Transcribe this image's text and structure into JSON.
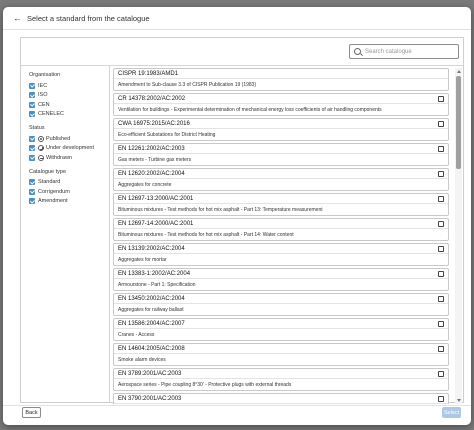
{
  "dialog": {
    "title": "Select a standard from the catalogue",
    "back_label": "Back",
    "select_label": "Select"
  },
  "search": {
    "placeholder": "Search catalogue"
  },
  "filters": {
    "organisation": {
      "title": "Organisation",
      "options": [
        {
          "label": "IEC",
          "checked": true
        },
        {
          "label": "ISO",
          "checked": true
        },
        {
          "label": "CEN",
          "checked": true
        },
        {
          "label": "CENELEC",
          "checked": true
        }
      ]
    },
    "status": {
      "title": "Status",
      "options": [
        {
          "label": "Published",
          "icon": "published-icon",
          "checked": true
        },
        {
          "label": "Under development",
          "icon": "under-development-icon",
          "checked": true
        },
        {
          "label": "Withdrawn",
          "icon": "withdrawn-icon",
          "checked": true
        }
      ]
    },
    "catalogue_type": {
      "title": "Catalogue type",
      "options": [
        {
          "label": "Standard",
          "checked": true
        },
        {
          "label": "Corrigendum",
          "checked": true
        },
        {
          "label": "Amendment",
          "checked": true
        }
      ]
    }
  },
  "standards": [
    {
      "code": "CISPR 19:1983/AMD1",
      "title": "Amendment to Sub-clause 3.3 of CISPR Publication 19 (1983)",
      "calendar": false
    },
    {
      "code": "CR 14378:2002/AC:2002",
      "title": "Ventilation for buildings - Experimental determination of mechanical energy loss coefficients of air handling components",
      "calendar": true
    },
    {
      "code": "CWA 16975:2015/AC:2016",
      "title": "Eco-efficient Substations for District Heating",
      "calendar": true
    },
    {
      "code": "EN 12261:2002/AC:2003",
      "title": "Gas meters - Turbine gas meters",
      "calendar": true
    },
    {
      "code": "EN 12620:2002/AC:2004",
      "title": "Aggregates for concrete",
      "calendar": true
    },
    {
      "code": "EN 12697-13:2000/AC:2001",
      "title": "Bituminous mixtures - Test methods for hot mix asphalt - Part 13: Temperature measurement",
      "calendar": true
    },
    {
      "code": "EN 12697-14:2000/AC:2001",
      "title": "Bituminous mixtures - Test methods for hot mix asphalt - Part 14: Water content",
      "calendar": true
    },
    {
      "code": "EN 13139:2002/AC:2004",
      "title": "Aggregates for mortar",
      "calendar": true
    },
    {
      "code": "EN 13383-1:2002/AC:2004",
      "title": "Armourstone - Part 1: Specification",
      "calendar": true
    },
    {
      "code": "EN 13450:2002/AC:2004",
      "title": "Aggregates for railway ballast",
      "calendar": true
    },
    {
      "code": "EN 13586:2004/AC:2007",
      "title": "Cranes - Access",
      "calendar": true
    },
    {
      "code": "EN 14604:2005/AC:2008",
      "title": "Smoke alarm devices",
      "calendar": true
    },
    {
      "code": "EN 3789:2001/AC:2003",
      "title": "Aerospace series - Pipe coupling 8°30' - Protective plugs with external threads",
      "calendar": true
    },
    {
      "code": "EN 3790:2001/AC:2003",
      "title": "",
      "calendar": true
    }
  ]
}
